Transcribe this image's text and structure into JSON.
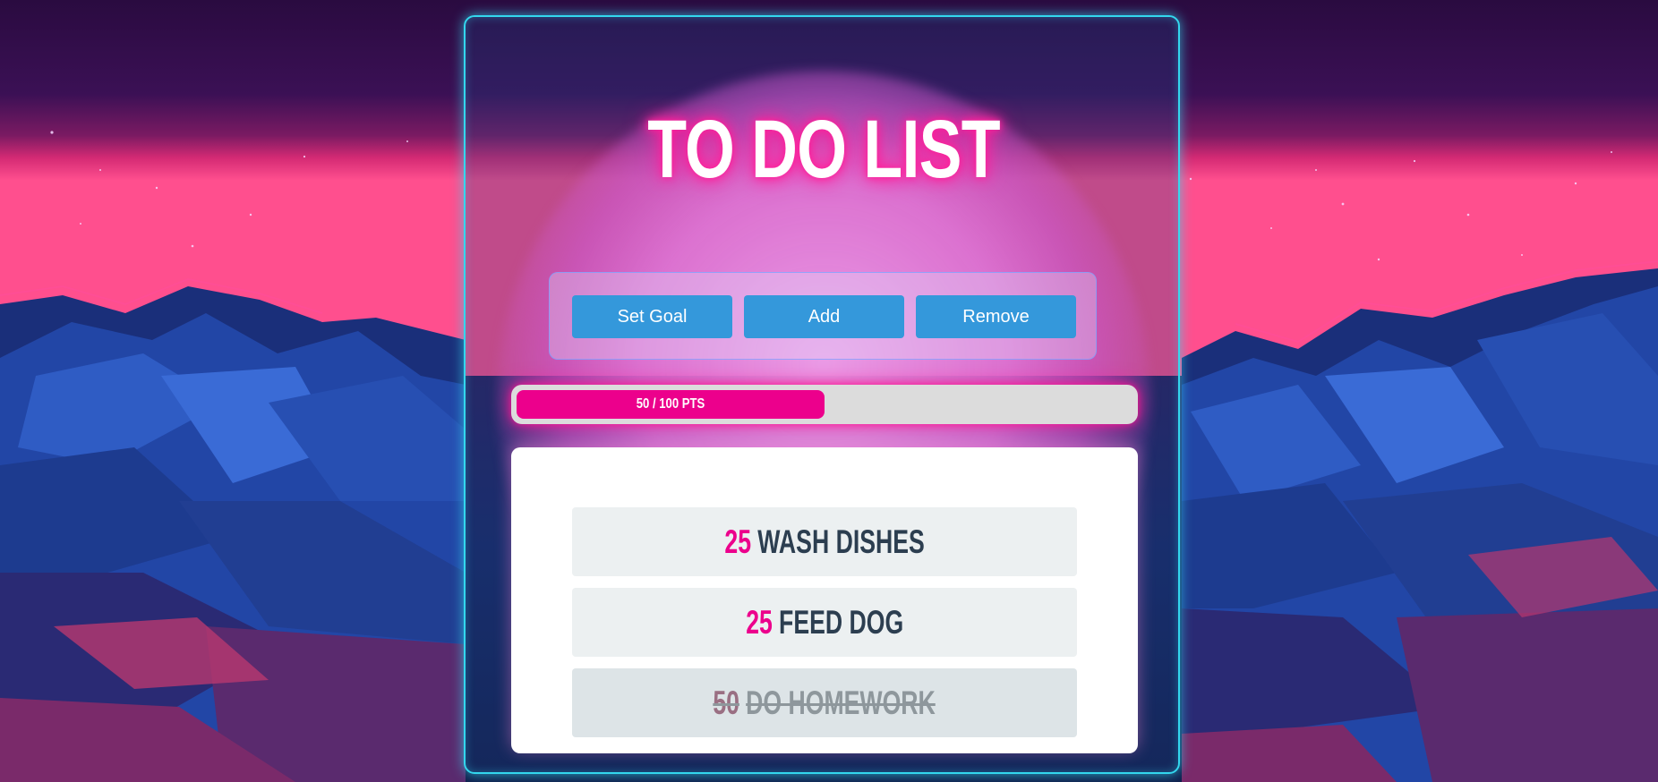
{
  "app": {
    "title": "TO DO LIST"
  },
  "controls": {
    "set_goal_label": "Set Goal",
    "add_label": "Add",
    "remove_label": "Remove"
  },
  "progress": {
    "current_points": 50,
    "goal_points": 100,
    "fraction": 0.5,
    "label": "50 / 100 PTS"
  },
  "tasks": [
    {
      "points": "25",
      "name": "WASH DISHES",
      "completed": false
    },
    {
      "points": "25",
      "name": "FEED DOG",
      "completed": false
    },
    {
      "points": "50",
      "name": "DO HOMEWORK",
      "completed": true
    }
  ],
  "colors": {
    "accent_pink": "#ec008c",
    "button_blue": "#3498db",
    "panel_border_cyan": "#33d7ee",
    "task_text_dark": "#2c3e50"
  }
}
